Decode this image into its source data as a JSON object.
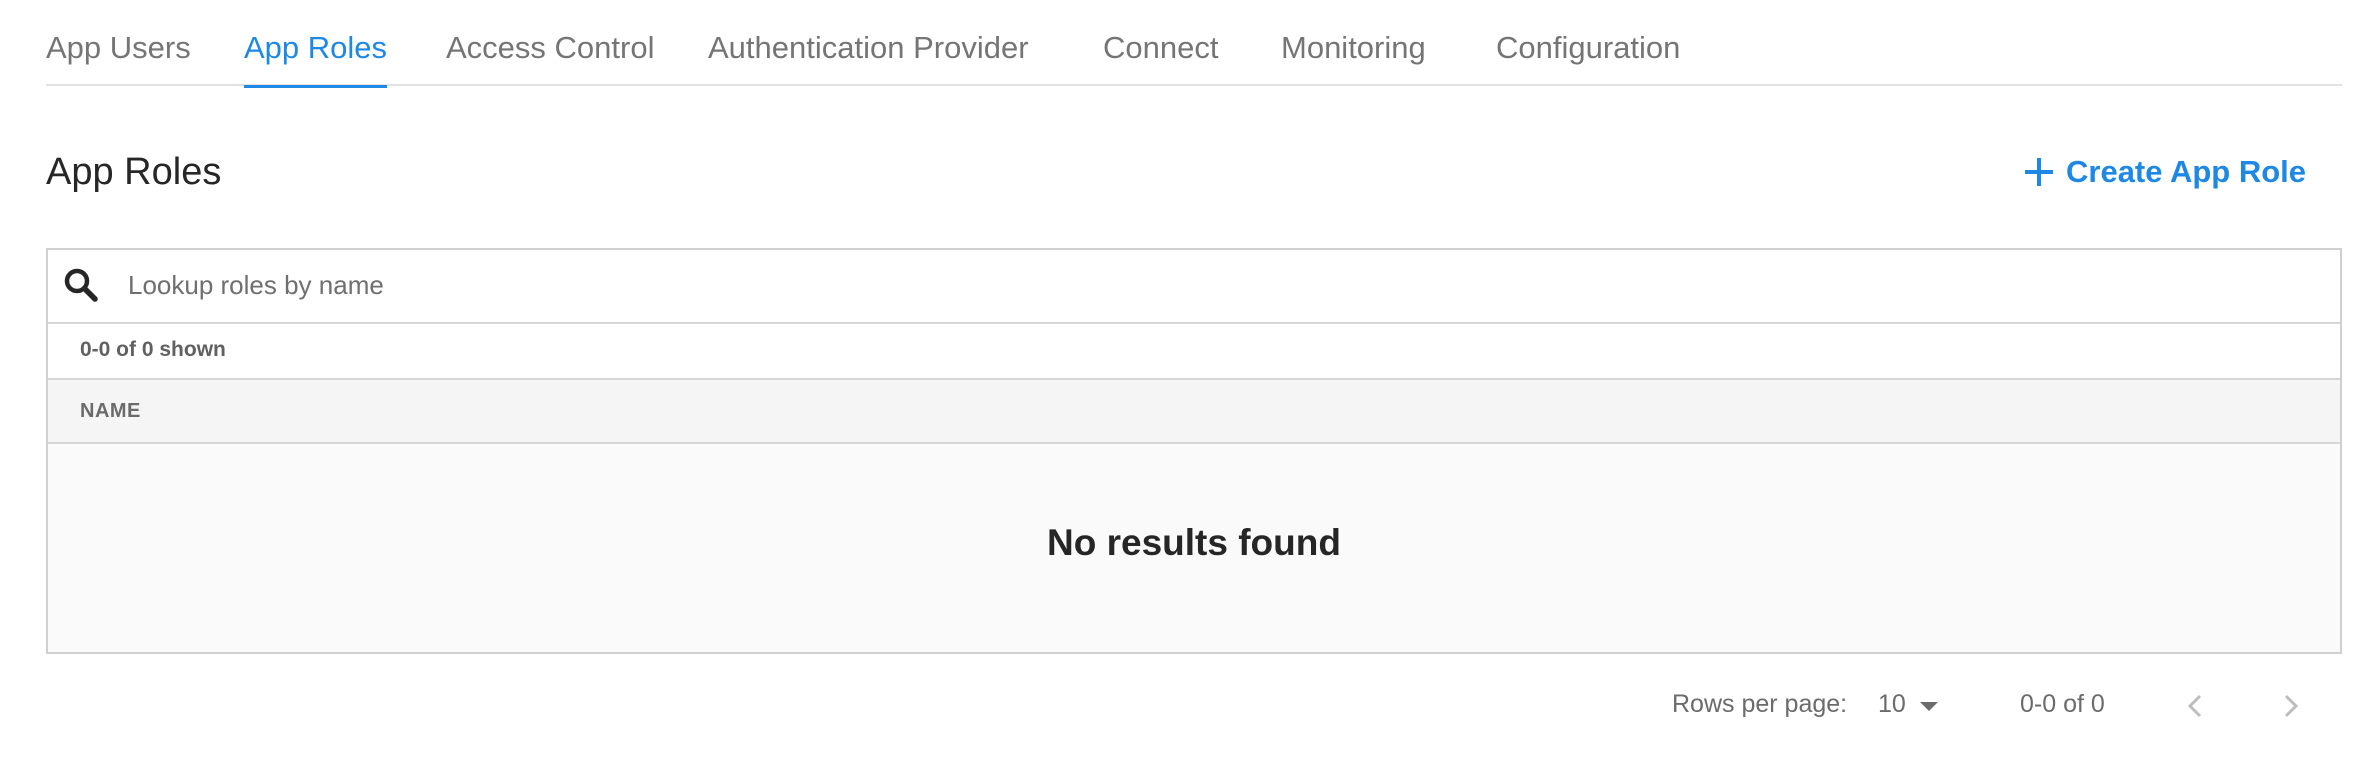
{
  "tabs": [
    {
      "label": "App Users",
      "active": false
    },
    {
      "label": "App Roles",
      "active": true
    },
    {
      "label": "Access Control",
      "active": false
    },
    {
      "label": "Authentication Provider",
      "active": false
    },
    {
      "label": "Connect",
      "active": false
    },
    {
      "label": "Monitoring",
      "active": false
    },
    {
      "label": "Configuration",
      "active": false
    }
  ],
  "header": {
    "title": "App Roles",
    "create_button_label": "Create App Role",
    "create_button_icon": "plus-icon"
  },
  "search": {
    "placeholder": "Lookup roles by name",
    "value": "",
    "icon": "search-icon"
  },
  "table": {
    "count_text": "0-0 of 0 shown",
    "columns": [
      "NAME"
    ],
    "rows": [],
    "empty_message": "No results found"
  },
  "pagination": {
    "rows_per_page_label": "Rows per page:",
    "rows_per_page_value": "10",
    "range_text": "0-0 of 0",
    "prev_icon": "chevron-left-icon",
    "next_icon": "chevron-right-icon"
  },
  "colors": {
    "accent": "#1e88e5",
    "text_primary": "#262626",
    "text_secondary": "#757575",
    "border": "#d0d0d0",
    "header_bg": "#f5f5f5"
  }
}
